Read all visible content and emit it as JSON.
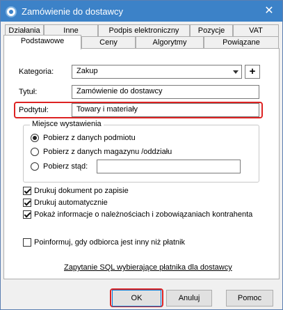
{
  "window": {
    "title": "Zamówienie do dostawcy",
    "close_glyph": "✕"
  },
  "tabs": {
    "row1": [
      "Działania",
      "Inne",
      "Podpis elektroniczny",
      "Pozycje",
      "VAT"
    ],
    "row2": [
      "Podstawowe",
      "Ceny",
      "Algorytmy",
      "Powiązane"
    ],
    "active": "Podstawowe"
  },
  "form": {
    "kategoria_label": "Kategoria:",
    "kategoria_value": "Zakup",
    "plus_label": "+",
    "tytul_label": "Tytuł:",
    "tytul_value": "Zamówienie do dostawcy",
    "podtytul_label": "Podtytuł:",
    "podtytul_value": "Towary i materiały"
  },
  "miejsce": {
    "title": "Miejsce wystawienia",
    "options": [
      {
        "label": "Pobierz z danych podmiotu",
        "checked": true
      },
      {
        "label": "Pobierz z danych magazynu /oddziału",
        "checked": false
      },
      {
        "label": "Pobierz stąd:",
        "checked": false
      }
    ],
    "stad_value": ""
  },
  "checks": [
    {
      "label": "Drukuj dokument po zapisie",
      "checked": true
    },
    {
      "label": "Drukuj automatycznie",
      "checked": true
    },
    {
      "label": "Pokaż informacje o należnościach i zobowiązaniach kontrahenta",
      "checked": true
    },
    {
      "label": "Poinformuj, gdy odbiorca jest inny niż płatnik",
      "checked": false
    }
  ],
  "sql_link": "Zapytanie SQL wybierające płatnika dla dostawcy",
  "buttons": {
    "ok": "OK",
    "cancel": "Anuluj",
    "help": "Pomoc"
  },
  "colors": {
    "titlebar": "#3c82c8",
    "highlight": "#dd2222"
  }
}
